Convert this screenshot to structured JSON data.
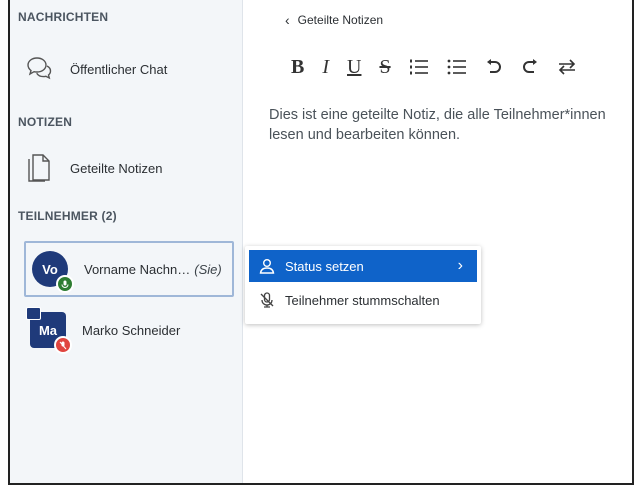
{
  "sidebar": {
    "messages_title": "NACHRICHTEN",
    "public_chat": {
      "label": "Öffentlicher Chat",
      "icon": "chat-bubbles-icon"
    },
    "notes_title": "NOTIZEN",
    "shared_notes": {
      "label": "Geteilte Notizen",
      "icon": "document-icon"
    },
    "participants_title": "TEILNEHMER (2)",
    "participants": [
      {
        "initials": "Vo",
        "name": "Vorname Nachn…",
        "suffix": "(Sie)",
        "badge_color": "#2e7d32",
        "badge_icon": "mic-icon"
      },
      {
        "initials": "Ma",
        "name": "Marko Schneider",
        "badge_color": "#e0453f",
        "badge_icon": "muted-mic-icon",
        "extra_icon": "presenter-screen-icon"
      }
    ]
  },
  "notes": {
    "back_label": "Geteilte Notizen",
    "toolbar": {
      "bold": "B",
      "italic": "I",
      "underline": "U",
      "strike": "S"
    },
    "text": "Dies ist eine geteilte Notiz, die alle Teilnehmer*innen lesen und bearbeiten können."
  },
  "context_menu": {
    "items": [
      {
        "label": "Status setzen",
        "icon": "user-icon"
      },
      {
        "label": "Teilnehmer stummschalten",
        "icon": "mute-mic-icon"
      }
    ]
  },
  "colors": {
    "accent": "#0f63c9",
    "avatar": "#1f3a7a",
    "sidebar_bg": "#f3f6f9"
  }
}
